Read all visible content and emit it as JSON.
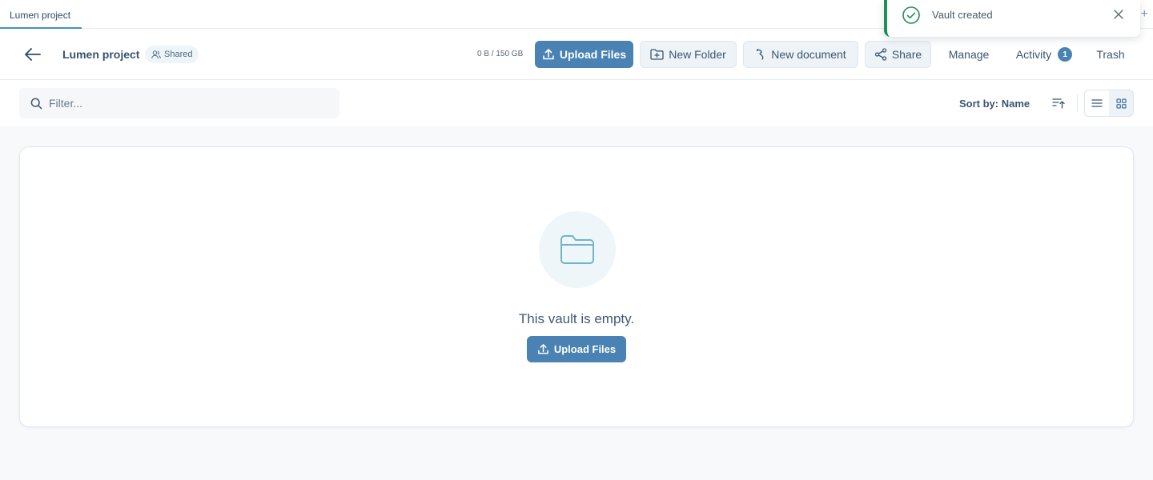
{
  "tabs": [
    {
      "label": "Lumen project"
    }
  ],
  "header": {
    "vault_name": "Lumen project",
    "shared_label": "Shared",
    "storage": "0 B / 150 GB",
    "upload_label": "Upload Files",
    "new_folder_label": "New Folder",
    "new_document_label": "New document",
    "share_label": "Share",
    "manage_label": "Manage",
    "activity_label": "Activity",
    "activity_count": "1",
    "trash_label": "Trash"
  },
  "toolbar": {
    "filter_placeholder": "Filter...",
    "sort_label": "Sort by: Name"
  },
  "empty_state": {
    "message": "This vault is empty.",
    "upload_label": "Upload Files"
  },
  "toast": {
    "message": "Vault created"
  },
  "colors": {
    "primary": "#4a82b3",
    "success": "#1e8f5a",
    "tab_accent": "#3d9ab3",
    "folder_icon": "#6fb5cc"
  }
}
